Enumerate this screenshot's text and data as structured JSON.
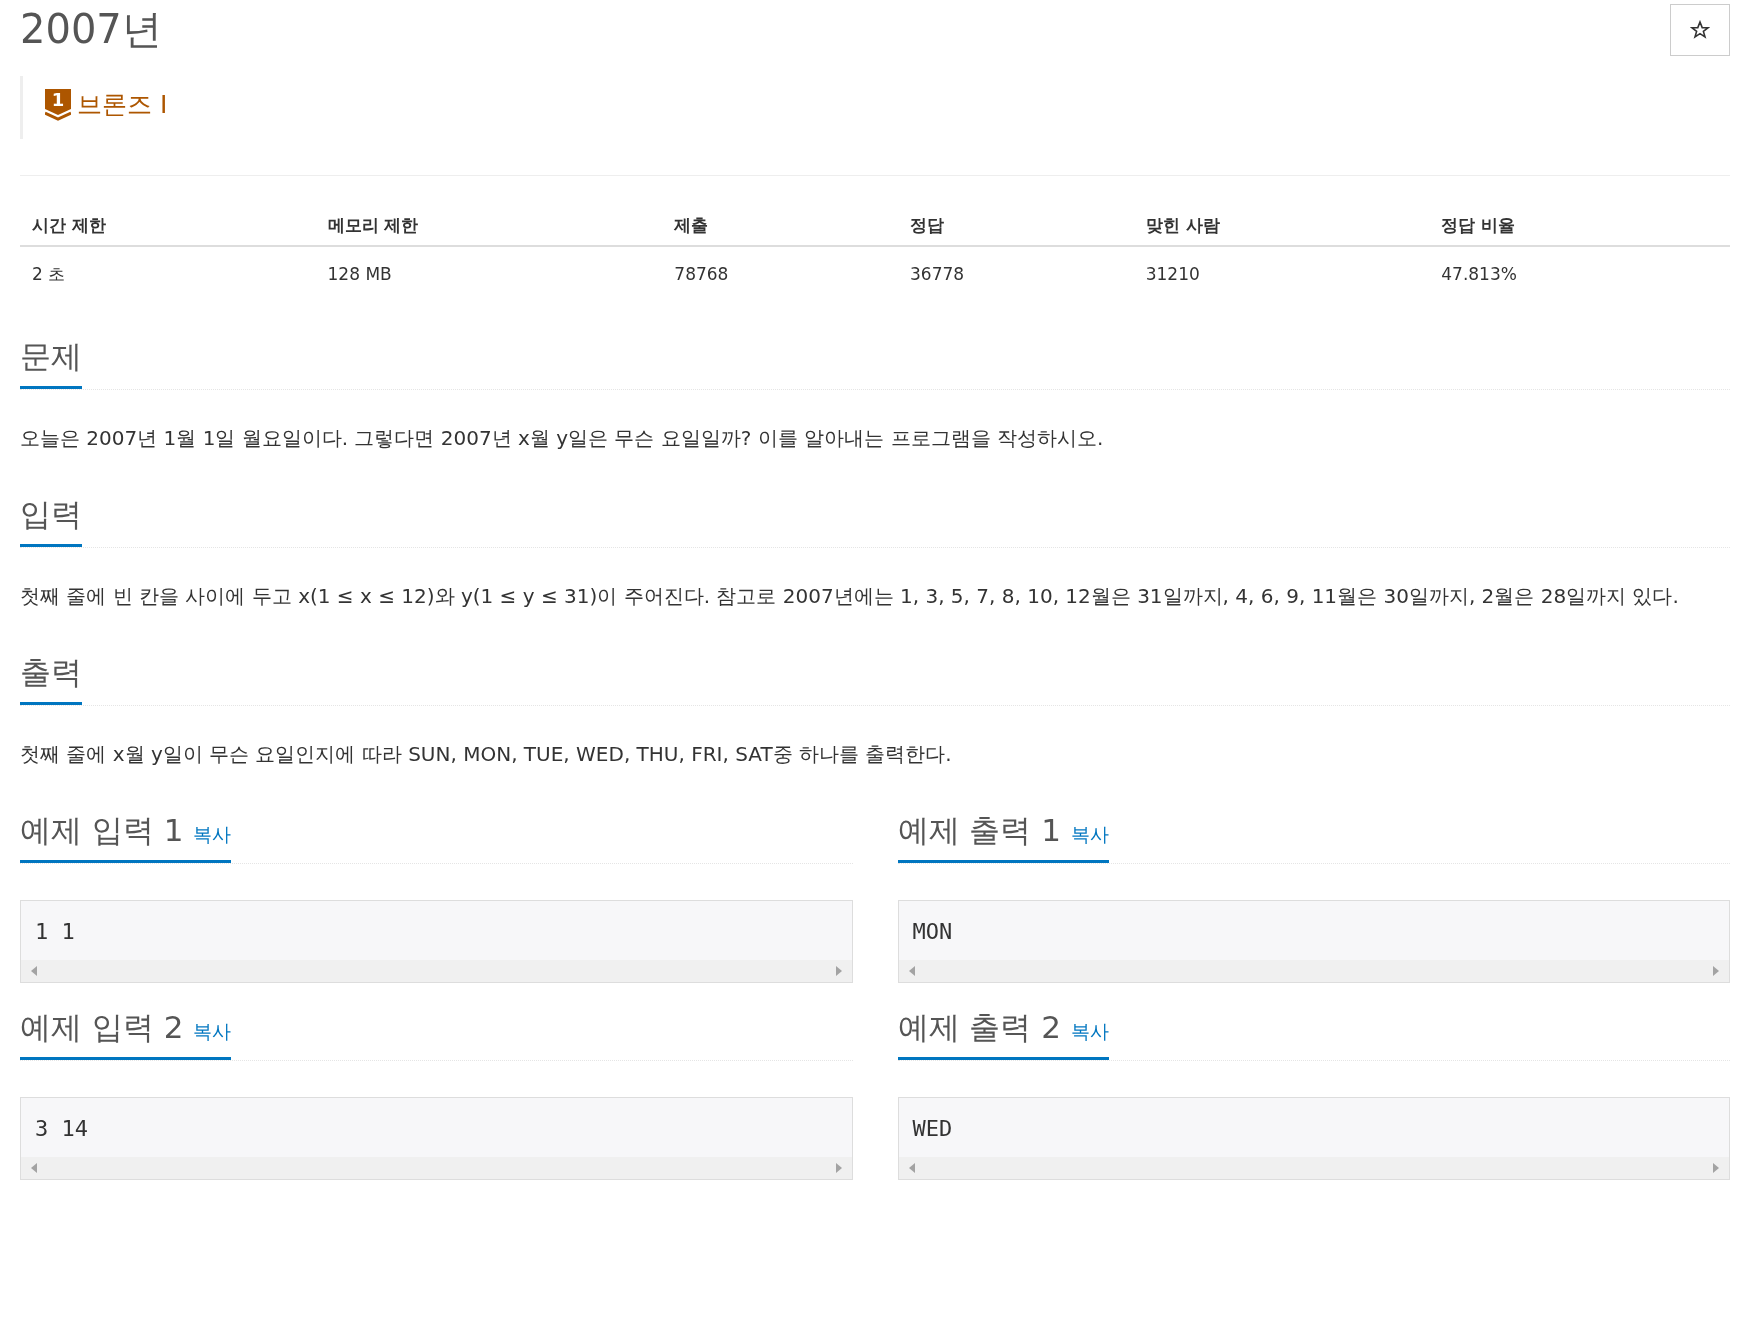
{
  "title": "2007년",
  "tier": {
    "number": "1",
    "label": "브론즈 I"
  },
  "stats": {
    "columns": [
      "시간 제한",
      "메모리 제한",
      "제출",
      "정답",
      "맞힌 사람",
      "정답 비율"
    ],
    "row": [
      "2 초",
      "128 MB",
      "78768",
      "36778",
      "31210",
      "47.813%"
    ]
  },
  "sections": [
    {
      "heading": "문제",
      "text": "오늘은 2007년 1월 1일 월요일이다. 그렇다면 2007년 x월 y일은 무슨 요일일까? 이를 알아내는 프로그램을 작성하시오."
    },
    {
      "heading": "입력",
      "text": "첫째 줄에 빈 칸을 사이에 두고 x(1 ≤ x ≤ 12)와 y(1 ≤ y ≤ 31)이 주어진다. 참고로 2007년에는 1, 3, 5, 7, 8, 10, 12월은 31일까지, 4, 6, 9, 11월은 30일까지, 2월은 28일까지 있다."
    },
    {
      "heading": "출력",
      "text": "첫째 줄에 x월 y일이 무슨 요일인지에 따라 SUN, MON, TUE, WED, THU, FRI, SAT중 하나를 출력한다."
    }
  ],
  "samples": [
    {
      "title": "예제 입력 1",
      "copy": "복사",
      "content": "1 1"
    },
    {
      "title": "예제 출력 1",
      "copy": "복사",
      "content": "MON"
    },
    {
      "title": "예제 입력 2",
      "copy": "복사",
      "content": "3 14"
    },
    {
      "title": "예제 출력 2",
      "copy": "복사",
      "content": "WED"
    }
  ]
}
